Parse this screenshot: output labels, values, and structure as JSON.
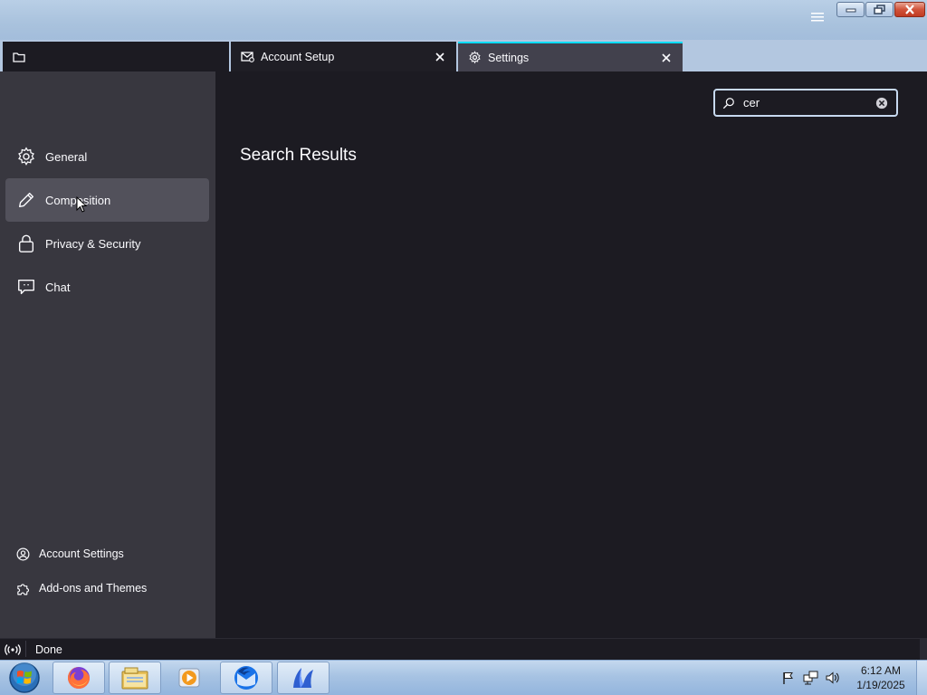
{
  "window": {
    "menu_icon": "hamburger-menu-icon",
    "controls": [
      "minimize",
      "restore",
      "close"
    ]
  },
  "tabs": [
    {
      "label": "",
      "icon": "folder-icon"
    },
    {
      "label": "Account Setup",
      "icon": "mail-setup-icon"
    },
    {
      "label": "Settings",
      "icon": "gear-icon",
      "active": true
    }
  ],
  "sidebar": {
    "items": [
      {
        "label": "General",
        "icon": "gear-icon"
      },
      {
        "label": "Composition",
        "icon": "pencil-icon",
        "selected": true
      },
      {
        "label": "Privacy & Security",
        "icon": "lock-icon"
      },
      {
        "label": "Chat",
        "icon": "chat-bubble-icon"
      }
    ],
    "footer": [
      {
        "label": "Account Settings",
        "icon": "account-gear-icon"
      },
      {
        "label": "Add-ons and Themes",
        "icon": "puzzle-icon"
      }
    ]
  },
  "search": {
    "value": "cer",
    "placeholder": ""
  },
  "main": {
    "title": "Search Results"
  },
  "status": {
    "text": "Done",
    "icon": "online-status-icon"
  },
  "taskbar": {
    "apps": [
      "firefox-icon",
      "file-explorer-icon",
      "media-player-icon",
      "thunderbird-icon",
      "app-icon"
    ],
    "clock_time": "6:12 AM",
    "clock_date": "1/19/2025"
  },
  "colors": {
    "background": "#1c1b22",
    "sidebar": "#38373f",
    "selected": "#52515b",
    "accent": "#00ddff",
    "text": "#fbfbfe"
  }
}
